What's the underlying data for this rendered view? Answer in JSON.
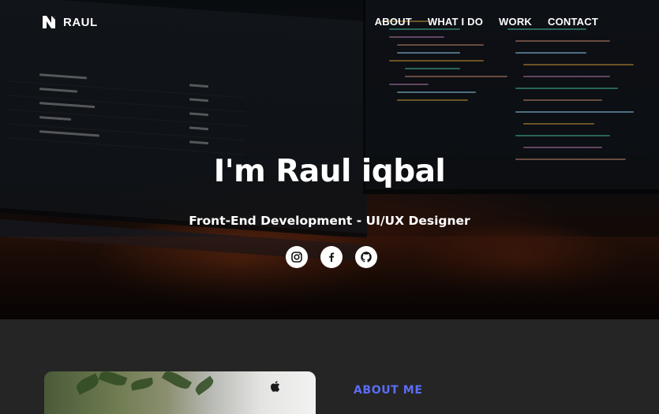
{
  "brand": {
    "name": "RAUL",
    "logo_icon": "n-logo-icon"
  },
  "nav": {
    "items": [
      {
        "label": "ABOUT"
      },
      {
        "label": "WHAT I DO"
      },
      {
        "label": "WORK"
      },
      {
        "label": "CONTACT"
      }
    ]
  },
  "hero": {
    "title": "I'm Raul iqbal",
    "subtitle": "Front-End Development - UI/UX Designer",
    "socials": [
      {
        "name": "instagram",
        "icon": "instagram-icon"
      },
      {
        "name": "facebook",
        "icon": "facebook-icon"
      },
      {
        "name": "github",
        "icon": "github-icon"
      }
    ]
  },
  "about": {
    "heading": "ABOUT ME",
    "accent_color": "#5b6ef5"
  },
  "colors": {
    "page_background": "#252525",
    "text": "#ffffff"
  }
}
